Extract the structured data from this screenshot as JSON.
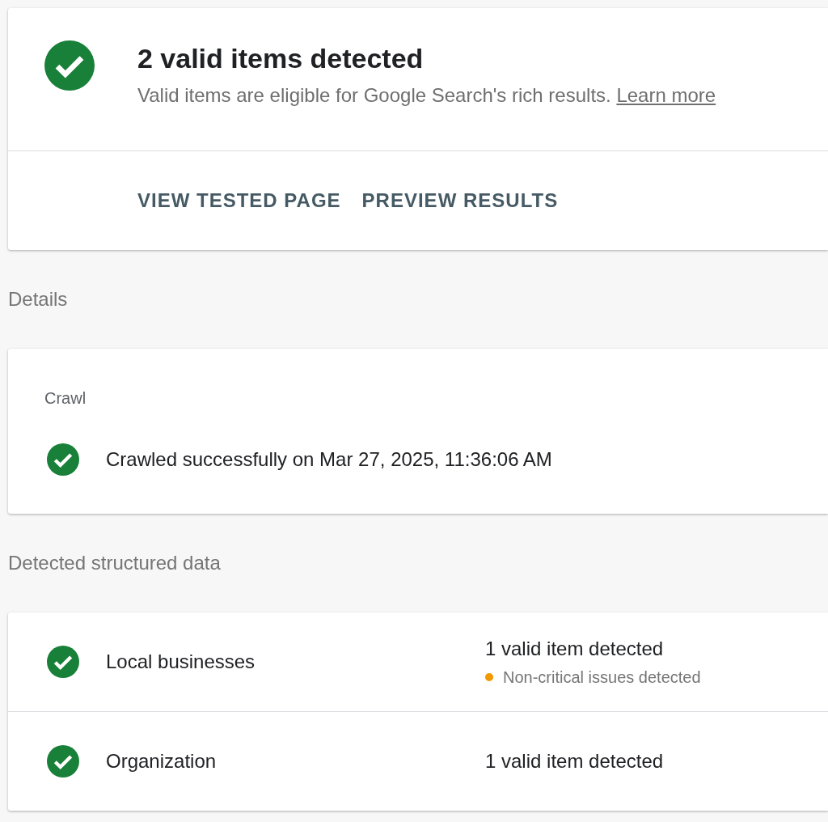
{
  "summary": {
    "kind": "valid",
    "title": "2 valid items detected",
    "subtitle": "Valid items are eligible for Google Search's rich results.",
    "link": "Learn more"
  },
  "actions": [
    "VIEW TESTED PAGE",
    "PREVIEW RESULTS"
  ],
  "details": {
    "heading": "Details",
    "card_title": "Crawl",
    "kind": "valid",
    "message": "Crawled successfully on Mar 27, 2025, 11:36:06 AM"
  },
  "structured_data": {
    "heading": "Detected structured data",
    "rows": [
      {
        "kind": "valid",
        "name": "Local businesses",
        "result": "1 valid item detected",
        "issue": {
          "text": "Non-critical issues detected",
          "color": "#f29900"
        }
      },
      {
        "kind": "valid",
        "name": "Organization",
        "result": "1 valid item detected"
      }
    ]
  }
}
